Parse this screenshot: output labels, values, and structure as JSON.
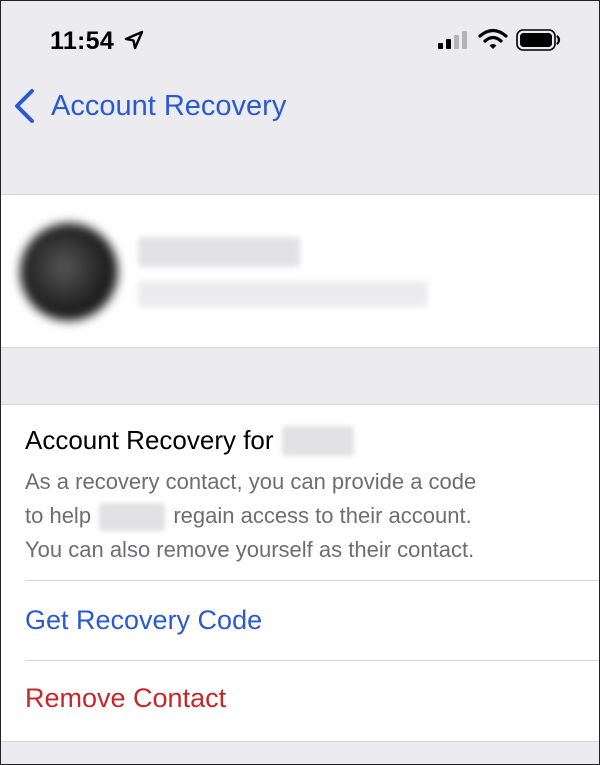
{
  "status_bar": {
    "time": "11:54",
    "icons": [
      "location-arrow-icon",
      "cellular-signal-icon",
      "wifi-icon",
      "battery-icon"
    ]
  },
  "nav": {
    "back_label": "Account Recovery",
    "back_icon": "chevron-left-icon"
  },
  "profile": {
    "name": "",
    "email": "",
    "avatar_icon": "avatar"
  },
  "info": {
    "heading_prefix": "Account Recovery for",
    "heading_name": "",
    "desc_line1": "As a recovery contact, you can provide a code",
    "desc_line2_pre": "to help",
    "desc_line2_name": "",
    "desc_line2_post": "regain access to their account.",
    "desc_line3": "You can also remove yourself as their contact."
  },
  "actions": {
    "get_code": "Get Recovery Code",
    "remove": "Remove Contact"
  },
  "colors": {
    "accent": "#2a5ad2",
    "destructive": "#c62828",
    "secondary_text": "#6d6d72",
    "background": "#ebebf0"
  }
}
